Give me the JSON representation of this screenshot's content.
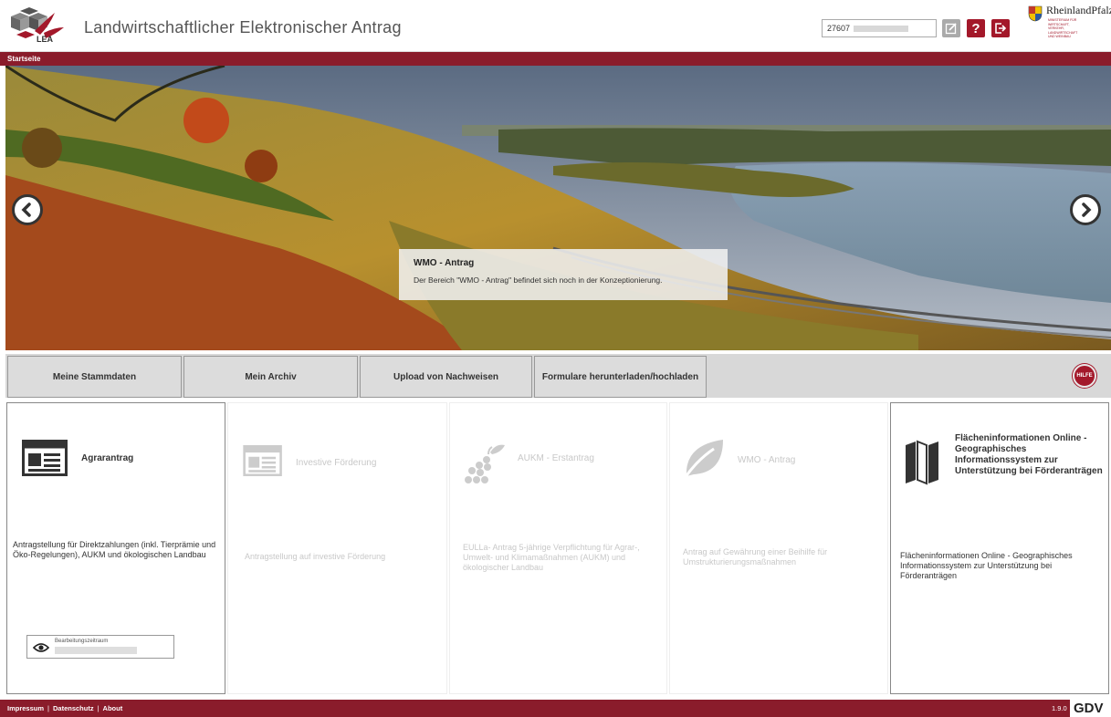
{
  "header": {
    "logo_text": "LEA",
    "app_title": "Landwirtschaftlicher Elektronischer Antrag",
    "user_number": "27607",
    "help_label": "?",
    "state_name": "RheinlandPfalz",
    "state_subtitle": "MINISTERIUM FÜR WIRTSCHAFT, VERKEHR, LANDWIRTSCHAFT UND WEINBAU"
  },
  "breadcrumb": {
    "current": "Startseite"
  },
  "slider": {
    "caption_title": "WMO - Antrag",
    "caption_text": "Der Bereich \"WMO - Antrag\" befindet sich noch in der Konzeptionierung."
  },
  "nav": {
    "buttons": [
      {
        "label": "Meine Stammdaten"
      },
      {
        "label": "Mein Archiv"
      },
      {
        "label": "Upload von Nachweisen"
      },
      {
        "label": "Formulare herunterladen/hochladen"
      }
    ],
    "help_label": "HILFE"
  },
  "cards": [
    {
      "title": "Agrarantrag",
      "description": "Antragstellung für Direktzahlungen (inkl. Tierprämie und Öko-Regelungen), AUKM und ökologischen Landbau",
      "icon": "newspaper-icon",
      "period_label": "Bearbeitungszeitraum",
      "enabled": true
    },
    {
      "title": "Investive Förderung",
      "description": "Antragstellung auf investive Förderung",
      "icon": "newspaper-icon",
      "enabled": false
    },
    {
      "title": "AUKM - Erstantrag",
      "description": "EULLa- Antrag 5-jährige Verpflichtung für Agrar-, Umwelt- und Klimamaßnahmen (AUKM) und ökologischer Landbau",
      "icon": "grapes-icon",
      "enabled": false
    },
    {
      "title": "WMO - Antrag",
      "description": "Antrag auf Gewährung einer Beihilfe für Umstrukturierungsmaßnahmen",
      "icon": "leaf-icon",
      "enabled": false
    },
    {
      "title": "Flächeninformationen Online - Geographisches Informationssystem zur Unterstützung bei Förderanträgen",
      "description": "Flächeninformationen Online - Geographisches Informationssystem zur Unterstützung bei Förderanträgen",
      "icon": "map-icon",
      "enabled": true
    }
  ],
  "footer": {
    "links": [
      "Impressum",
      "Datenschutz",
      "About"
    ],
    "version": "1.9.0",
    "vendor_logo": "GDV"
  },
  "colors": {
    "brand": "#8a1c2b",
    "accent": "#a3182a"
  }
}
